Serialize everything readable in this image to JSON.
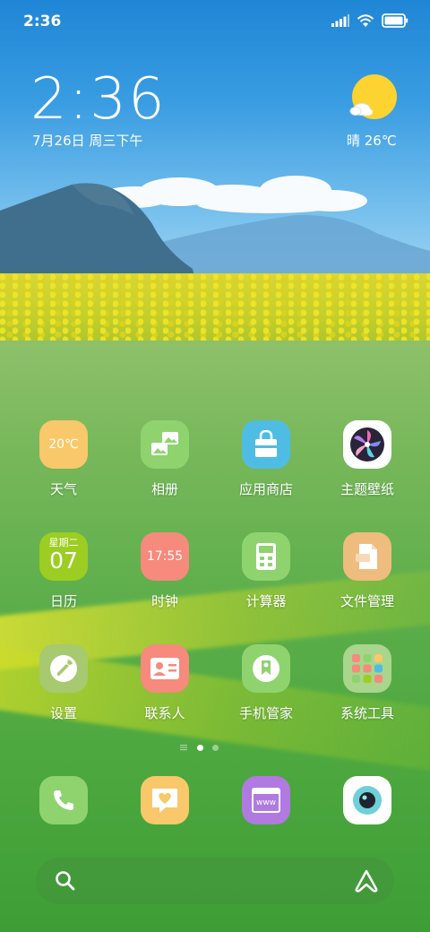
{
  "status_bar": {
    "time": "2:36"
  },
  "clock_widget": {
    "time": "2:36",
    "date": "7月26日 周三下午",
    "weather": "晴 26℃"
  },
  "apps": [
    {
      "label": "天气",
      "icon": "weather-icon-app",
      "icon_text": "20℃",
      "color": "#f9c86a"
    },
    {
      "label": "相册",
      "icon": "gallery-icon",
      "color": "#8fd36f"
    },
    {
      "label": "应用商店",
      "icon": "app-store-bag-icon",
      "color": "#4fbde3"
    },
    {
      "label": "主题壁纸",
      "icon": "themes-flower-icon",
      "color": "#ffffff"
    },
    {
      "label": "日历",
      "icon": "calendar-icon",
      "icon_text_top": "星期二",
      "icon_text": "07",
      "color": "#9ccd22"
    },
    {
      "label": "时钟",
      "icon": "clock-icon",
      "icon_text": "17:55",
      "color": "#f58a7d"
    },
    {
      "label": "计算器",
      "icon": "calculator-icon",
      "color": "#8fd36f"
    },
    {
      "label": "文件管理",
      "icon": "file-manager-icon",
      "color": "#eebc7e"
    },
    {
      "label": "设置",
      "icon": "settings-wrench-icon",
      "color": "#a7c96f"
    },
    {
      "label": "联系人",
      "icon": "contacts-card-icon",
      "color": "#f58a7d"
    },
    {
      "label": "手机管家",
      "icon": "security-shield-icon",
      "color": "#8fd36f"
    },
    {
      "label": "系统工具",
      "icon": "folder-icon",
      "color": "#bfdc8e"
    }
  ],
  "page_indicator": {
    "pages": 2,
    "current": 1
  },
  "dock": [
    {
      "name": "phone",
      "icon": "phone-icon",
      "color": "#8fd36f"
    },
    {
      "name": "messages",
      "icon": "message-heart-icon",
      "color": "#f9c86a"
    },
    {
      "name": "browser",
      "icon": "browser-www-icon",
      "icon_text": "www",
      "color": "#b07ae0"
    },
    {
      "name": "camera",
      "icon": "camera-lens-icon",
      "color": "#ffffff"
    }
  ]
}
